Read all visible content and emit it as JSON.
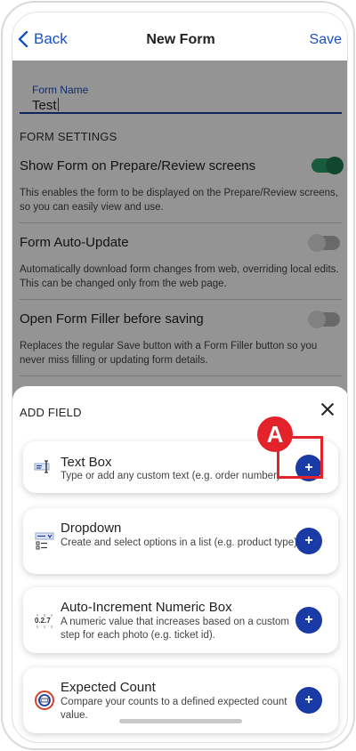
{
  "nav": {
    "back_label": "Back",
    "title": "New Form",
    "save_label": "Save"
  },
  "form_name": {
    "label": "Form Name",
    "value": "Test"
  },
  "form_settings": {
    "section_title": "FORM SETTINGS",
    "items": [
      {
        "title": "Show Form on Prepare/Review screens",
        "description": "This enables the form to be displayed on the Prepare/Review screens, so you can easily view and use.",
        "enabled": true
      },
      {
        "title": "Form Auto-Update",
        "description": "Automatically download form changes from web, overriding local edits. This can be changed only from the web page.",
        "enabled": false
      },
      {
        "title": "Open Form Filler before saving",
        "description": "Replaces the regular Save button with a Form Filler button so you never miss filling or updating form details.",
        "enabled": false
      }
    ]
  },
  "add_field_sheet": {
    "title": "ADD FIELD",
    "fields": [
      {
        "icon": "text-box-icon",
        "title": "Text Box",
        "description": "Type or add any custom text (e.g. order number).",
        "add_label": "+"
      },
      {
        "icon": "dropdown-icon",
        "title": "Dropdown",
        "description": "Create and select options in a list (e.g. product type).",
        "add_label": "+"
      },
      {
        "icon": "numeric-box-icon",
        "title": "Auto-Increment Numeric Box",
        "description": "A numeric value that increases based on a custom step for each photo (e.g. ticket id).",
        "add_label": "+"
      },
      {
        "icon": "expected-count-icon",
        "title": "Expected Count",
        "description": "Compare your counts to a defined expected count value.",
        "add_label": "+"
      }
    ]
  },
  "annotation": {
    "label": "A",
    "color": "#e2232a"
  },
  "colors": {
    "accent": "#1a4fc4",
    "button": "#1a3aa6",
    "toggle_on": "#2a9d6a"
  }
}
